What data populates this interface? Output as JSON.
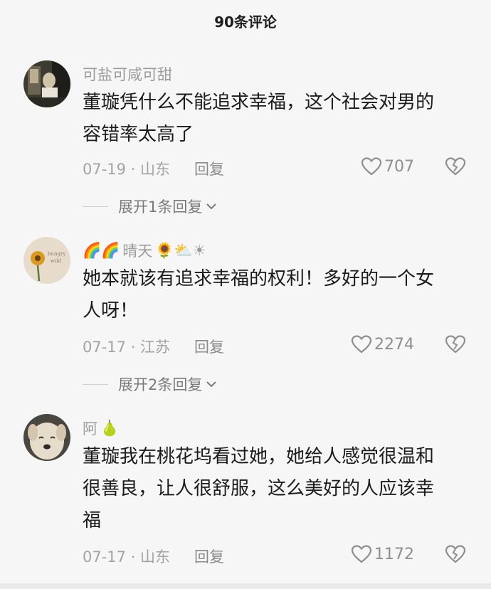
{
  "header": {
    "title": "90条评论"
  },
  "comments": [
    {
      "user": "可盐可咸可甜",
      "text_line1": "董璇凭什么不能追求幸福，这个社会对男的",
      "text_line2": "容错率太高了",
      "date": "07-19 · 山东",
      "reply_label": "回复",
      "likes": "707",
      "expand_label": "展开1条回复"
    },
    {
      "user_prefix": "🌈🌈",
      "user": "晴天",
      "user_suffix": "🌻⛅☀",
      "text_line1": "她本就该有追求幸福的权利！多好的一个女",
      "text_line2": "人呀！",
      "date": "07-17 · 江苏",
      "reply_label": "回复",
      "likes": "2274",
      "expand_label": "展开2条回复"
    },
    {
      "user": "阿",
      "user_suffix": "🍐",
      "text_line1": "董璇我在桃花坞看过她，她给人感觉很温和",
      "text_line2": "很善良，让人很舒服，这么美好的人应该幸",
      "text_line3": "福",
      "date": "07-17 · 山东",
      "reply_label": "回复",
      "likes": "1172"
    }
  ],
  "icons": {
    "like": "heart-outline-icon",
    "dislike": "broken-heart-icon",
    "expand": "chevron-down-icon"
  },
  "colors": {
    "background": "#f6f6f6",
    "meta": "#a3a3a3",
    "text": "#1b1b1b"
  }
}
